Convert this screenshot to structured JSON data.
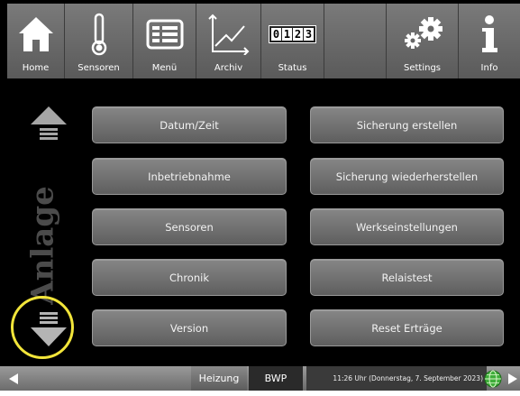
{
  "toolbar": {
    "home": {
      "label": "Home",
      "icon": "home-icon"
    },
    "sensors": {
      "label": "Sensoren",
      "icon": "thermometer-icon"
    },
    "menu": {
      "label": "Menü",
      "icon": "menu-icon"
    },
    "archive": {
      "label": "Archiv",
      "icon": "chart-icon"
    },
    "status": {
      "label": "Status",
      "icon": "counter-icon",
      "counter": [
        "0",
        "1",
        "2",
        "3"
      ]
    },
    "settings": {
      "label": "Settings",
      "icon": "gears-icon"
    },
    "info": {
      "label": "Info",
      "icon": "info-icon"
    }
  },
  "side": {
    "label": "Anlage",
    "up_icon": "scroll-up-icon",
    "down_icon": "scroll-down-icon",
    "highlight_color": "#f2e53a"
  },
  "buttons": {
    "left": [
      "Datum/Zeit",
      "Inbetriebnahme",
      "Sensoren",
      "Chronik",
      "Version"
    ],
    "right": [
      "Sicherung erstellen",
      "Sicherung wiederherstellen",
      "Werkseinstellungen",
      "Relaistest",
      "Reset Erträge"
    ]
  },
  "statusbar": {
    "tab_heating": "Heizung",
    "tab_bwp": "BWP",
    "clock": "11:26 Uhr (Donnerstag, 7. September 2023)",
    "globe_icon": "globe-icon",
    "prev_icon": "left-arrow-icon",
    "next_icon": "right-arrow-icon"
  }
}
